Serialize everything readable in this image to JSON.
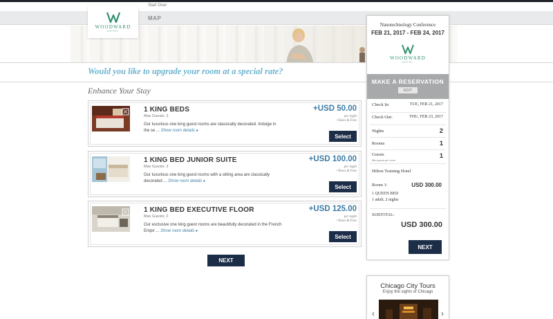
{
  "header": {
    "start_over": "Start Over",
    "nav_map": "MAP",
    "logo_name": "WOODWARD",
    "logo_sub": "HOTEL"
  },
  "upgrade_prompt": "Would you like to upgrade your room at a special rate?",
  "enhance_title": "Enhance Your Stay",
  "rooms": [
    {
      "name": "1 KING BEDS",
      "max_guests": "Max Guests: 3",
      "description": "Our luxurious one king guest rooms are classically decorated. Indulge in the se ...",
      "details_link": "Show room details",
      "price": "+USD 50.00",
      "price_unit": "per night",
      "price_taxes": "+Taxes & Fees",
      "select_label": "Select"
    },
    {
      "name": "1 KING BED JUNIOR SUITE",
      "max_guests": "Max Guests: 3",
      "description": "Our luxurious one king guest rooms with a sitting area are classically decorated ...",
      "details_link": "Show room details",
      "price": "+USD 100.00",
      "price_unit": "per night",
      "price_taxes": "+Taxes & Fees",
      "select_label": "Select"
    },
    {
      "name": "1 KING BED EXECUTIVE FLOOR",
      "max_guests": "Max Guests: 2",
      "description": "Our exclusive one king guest rooms are beautifully decorated in the French Empir ...",
      "details_link": "Show room details",
      "price": "+USD 125.00",
      "price_unit": "per night",
      "price_taxes": "+Taxes & Fees",
      "select_label": "Select"
    }
  ],
  "next_label": "NEXT",
  "reservation": {
    "conference": "Nanotechnology Conference",
    "dates": "FEB 21, 2017 - FEB 24, 2017",
    "logo_name": "WOODWARD",
    "logo_sub": "HOTEL",
    "title": "MAKE A RESERVATION",
    "edit_label": "EDIT",
    "check_in_label": "Check In:",
    "check_in_value": "TUE, FEB 21, 2017",
    "check_out_label": "Check Out:",
    "check_out_value": "THU, FEB 23, 2017",
    "nights_label": "Nights",
    "nights_value": "2",
    "rooms_label": "Rooms",
    "rooms_value": "1",
    "guests_label": "Guests",
    "guests_sub": "Max guests per room",
    "guests_value": "1",
    "hotel_name": "Hilton Training Hotel",
    "room1_label": "Room 1:",
    "room1_price": "USD 300.00",
    "room1_type": "1 QUEEN BED",
    "room1_detail": "1 adult, 2 nights",
    "subtotal_label": "SUBTOTAL:",
    "subtotal_value": "USD 300.00",
    "next_label": "NEXT"
  },
  "ad": {
    "title": "Chicago City Tours",
    "subtitle": "Enjoy the sights of Chicago"
  },
  "colors": {
    "brand_green": "#2f8f6a",
    "accent_blue": "#3b7aa4",
    "button_navy": "#1c2d48",
    "upgrade_blue": "#6cb4cf",
    "panel_gray": "#a7a9ab"
  }
}
